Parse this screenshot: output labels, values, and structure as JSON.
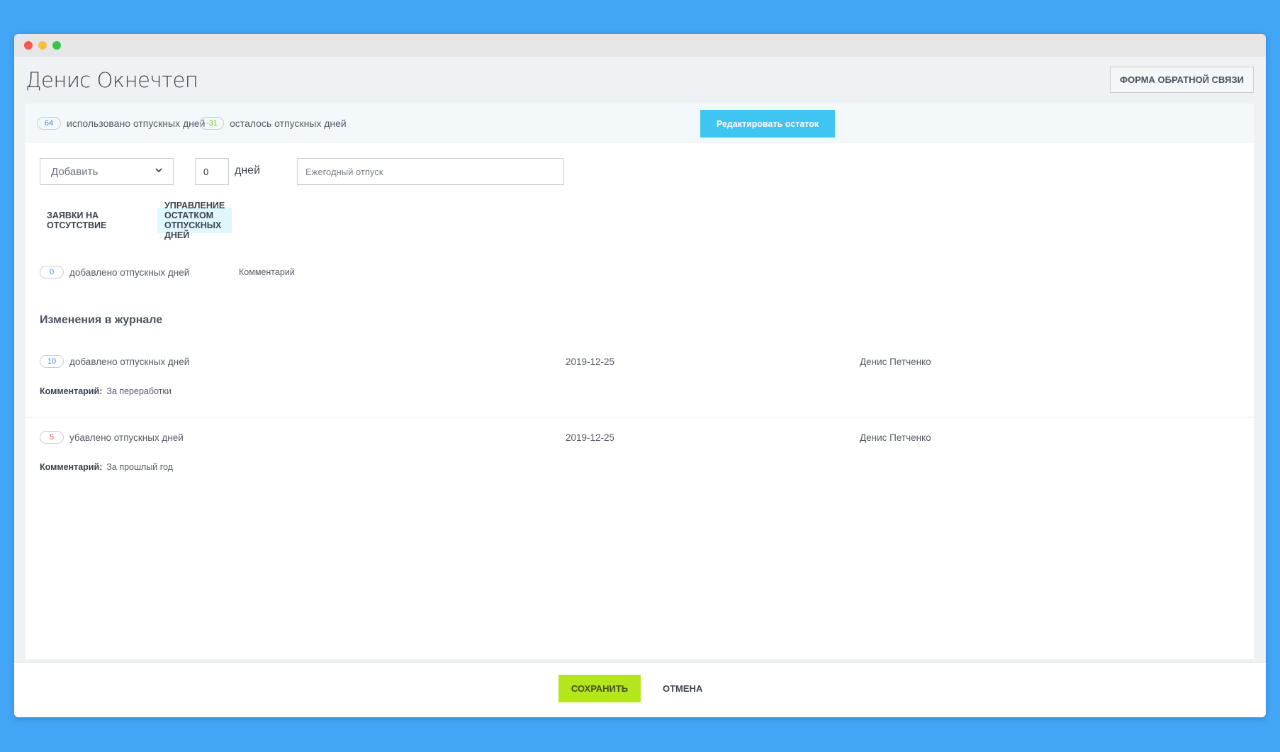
{
  "window": {
    "title": "Денис Окнечтеп"
  },
  "header": {
    "feedback_button": "ФОРМА ОБРАТНОЙ СВЯЗИ"
  },
  "summary": {
    "used_count": "64",
    "used_label": "использовано отпускных дней",
    "remaining_count": "-31",
    "remaining_label": "осталось отпускных дней",
    "edit_button": "Редактировать остаток"
  },
  "controls": {
    "action_select": "Добавить",
    "days_value": "0",
    "days_label": "дней",
    "type_placeholder": "Ежегодный отпуск"
  },
  "tabs": [
    {
      "label": "ЗАЯВКИ НА ОТСУТСТВИЕ",
      "active": false
    },
    {
      "label": "УПРАВЛЕНИЕ ОСТАТКОМ ОТПУСКНЫХ ДНЕЙ",
      "active": true
    }
  ],
  "added": {
    "count": "0",
    "label": "добавлено отпускных дней",
    "comment_label": "Комментарий"
  },
  "log": {
    "title": "Изменения в журнале",
    "comment_key": "Комментарий:",
    "entries": [
      {
        "count": "10",
        "label": "добавлено отпускных дней",
        "date": "2019-12-25",
        "user": "Денис Петченко",
        "comment": "За переработки"
      },
      {
        "count": "5",
        "label": "убавлено отпускных дней",
        "date": "2019-12-25",
        "user": "Денис Петченко",
        "comment": "За прошлый год"
      }
    ]
  },
  "footer": {
    "save_button": "СОХРАНИТЬ",
    "cancel_button": "ОТМЕНА"
  },
  "colors": {
    "background": "#42a5f5",
    "accent_blue": "#3ec5f2",
    "save_green": "#b5e61d",
    "active_tab": "#e0f7fd"
  }
}
